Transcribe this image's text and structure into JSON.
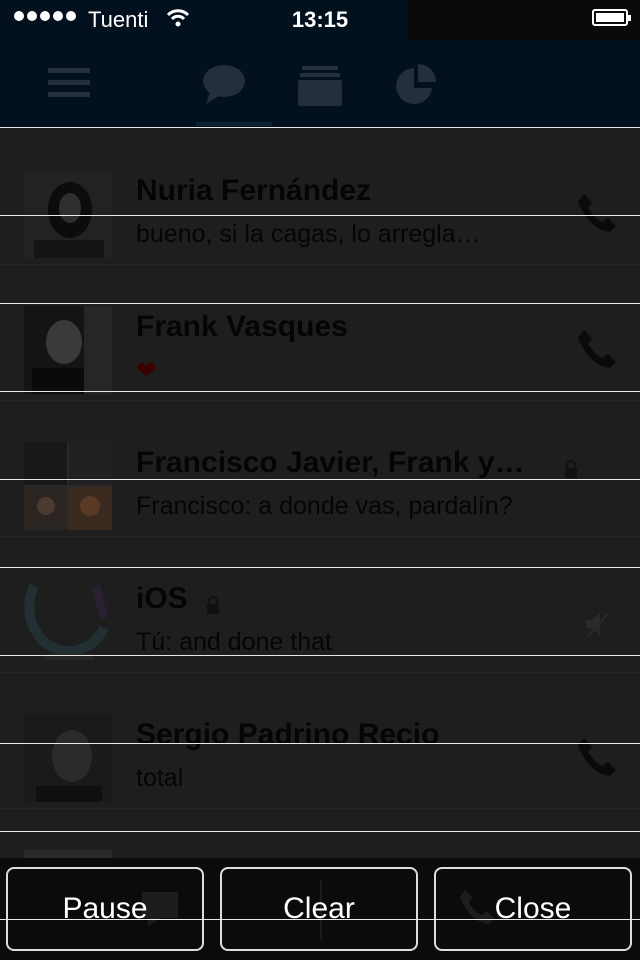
{
  "status_bar": {
    "carrier": "Tuenti",
    "time": "13:15",
    "battery_level": 1.0
  },
  "nav": {
    "icons": [
      "menu-icon",
      "chat-bubble-icon",
      "contacts-icon",
      "pie-chart-icon"
    ]
  },
  "conversations": [
    {
      "name": "Nuria Fernández",
      "message": "bueno, si la cagas, lo arregla…",
      "action": "phone-icon",
      "locked": false
    },
    {
      "name": "Frank Vasques",
      "message": "❤",
      "action": "phone-icon",
      "locked": false
    },
    {
      "name": "Francisco Javier, Frank y…",
      "message": "Francisco: a donde vas, pardalín?",
      "action": "",
      "locked": true
    },
    {
      "name": "iOS",
      "message": "Tú: and done that",
      "action": "muted-speaker-icon",
      "locked": true
    },
    {
      "name": "Sergio Padrino Recio",
      "message": "total",
      "action": "phone-icon",
      "locked": false
    }
  ],
  "toolbar": {
    "pause_label": "Pause",
    "clear_label": "Clear",
    "close_label": "Close"
  },
  "colors": {
    "nav_background": "#03101e",
    "list_background": "#1e1e1e",
    "text": "#050505",
    "overlay_line": "#e8e8e8"
  }
}
